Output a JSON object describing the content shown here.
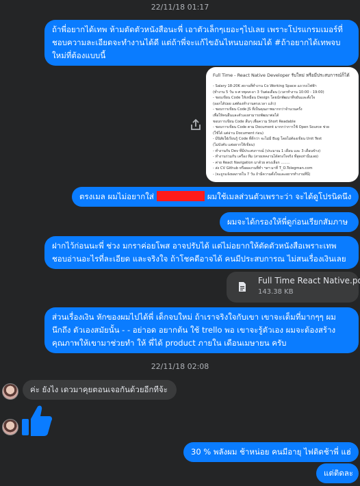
{
  "timestamps": [
    "22/11/18 01:17",
    "22/11/18 02:08"
  ],
  "messages": {
    "m1": "ถ้าพี่อยากได้เทพ ห้ามตัดตัวหนังสือนะพี่ เอาตัวเล็กๆเยอะๆไปเลย เพราะโปรแกรมเมอร์ที่ชอบความละเอียดจะทำงานได้ดี แต่ถ้าพี่จะแก้ไขอันไหนบอกผมได้ #ถ้าอยากได้เทพจบใหม่ที่ต้องแบบนี้",
    "m2_a": "ตรงเมล ผมไม่อยากใส่",
    "m2_b": "ผมใช้เมลส่วนตัวเพราะว่า จะได้ดูโปรนิดนึง",
    "m3": "ผมจะได้กรองให้พี่ดูก่อนเรียกสัมภาษ",
    "m4": "ฝากไว้ก่อนนะพี่ ช่วง มกราค่อยโพส อาจปรับได้ แต่ไม่อยากให้ตัดตัวหนังสือเพราะเทพชอบอ่านอะไรที่ละเอียด และจริงใจ ถ้าโชคดีอาจได้ คนมีประสบการณ ไม่สนเรื่องเงินเลย",
    "m5": "ส่วนเรื่องเงิน หักของผมไปได้พี่ เด็กจบใหม่ ถ้าเราจริงใจกับเขา เขาจะเต็มที่มากๆๆ ผมนึกถึง ตัวเองสมัยนั้น - - อย่าอด อยากต้น ใช้ trello พอ เขาจะรู้ตัวเอง ผมจะต้องสร้างคุณภาพให้เขามาช่วยทำ ให้ พี่ได้ product ภายใน เดือนเมษายน ครับ",
    "m6": "ค่ะ ยังไง เดวมาคุยตอนเจอกันด้วยอีกทีจ้ะ",
    "m7": "30 % พลังผม ช้าหน่อย คนมีอายุ ไฟติดช้าพี่ แฮ่",
    "m8": "แต่ติดละ"
  },
  "document_image": {
    "title": "Full Time - React Native Developer รับใหม่ หรือมีประสบการณ์ก็ได้",
    "lines": [
      "- Salary 18-20K สถานที่ทำงาน Co Working Space แถวรถไฟฟ้า",
      "(ทำงาน 5 วัน จ-ศ หยุดส-อา 3 วันต่อเดือน (เวลาทำงาน 10:00 - 19:00)",
      "- ชอบเขียน Code ให้เหมือน Design โดยนักพัฒนาที่ขยันและตั้งใจ",
      "(ออกได้บ่อย แต่ต้องทำงานตรงเวลา แล้ว)",
      "- ชอบการเขียน Code JS ที่เป็นคุณภาพมากกว่าจำนวนครั้ง",
      "เพื่อให้คนอื่นและตัวเองสามารถพัฒนาต่อได้",
      "   ชอบการเขียน Code สั้นๆ เพื่อความ Short Readable",
      "- ชอบการเขียน Code ตาม Document มากกว่าการใช้ Open Source ช่วย",
      "(ใช้ได้ แต่อ่าน Document ก่อน)",
      "- มีนิสัยใฝ่เรียนรู้ Code ที่ดีกว่า จะไม่มี Bug โดยไม่ต้องเขียน Unit Test",
      "(ไม่บังคับ แต่อยากให้เขียน)",
      "- ทำงานกับ Dev ที่มีประสบการณ์ (ประมาณ 1 เดือน และ 3 เดือนข้าง)",
      "- ทำงานร่วมกับ เครื่อง ทีม (สายเทคงานได้ตรงใจจริง ที่สุดเท่านั้นเลย)",
      "- ค่าย React Navigation มาด้วย ตรงเลือก ........",
      "- ส่ง CV Github หรือผลงานที่ทำ ฯลฯ มาที่ T_O.Tolegman.com",
      "- (จะถูกแจ้งผลภายใน 7 วัน ถ้ามีความตั้งใจและอยากทำงานที่นี่)"
    ]
  },
  "attachment": {
    "name": "Full Time React Native.pdf",
    "size": "143.38 KB",
    "icon": "file-icon"
  },
  "icons": {
    "share": "share-icon",
    "like": "thumbs-up-icon"
  },
  "colors": {
    "background": "#242526",
    "sent_bubble": "#0a7cff",
    "received_bubble": "#3a3b3c",
    "redaction": "#ff1a1a"
  }
}
